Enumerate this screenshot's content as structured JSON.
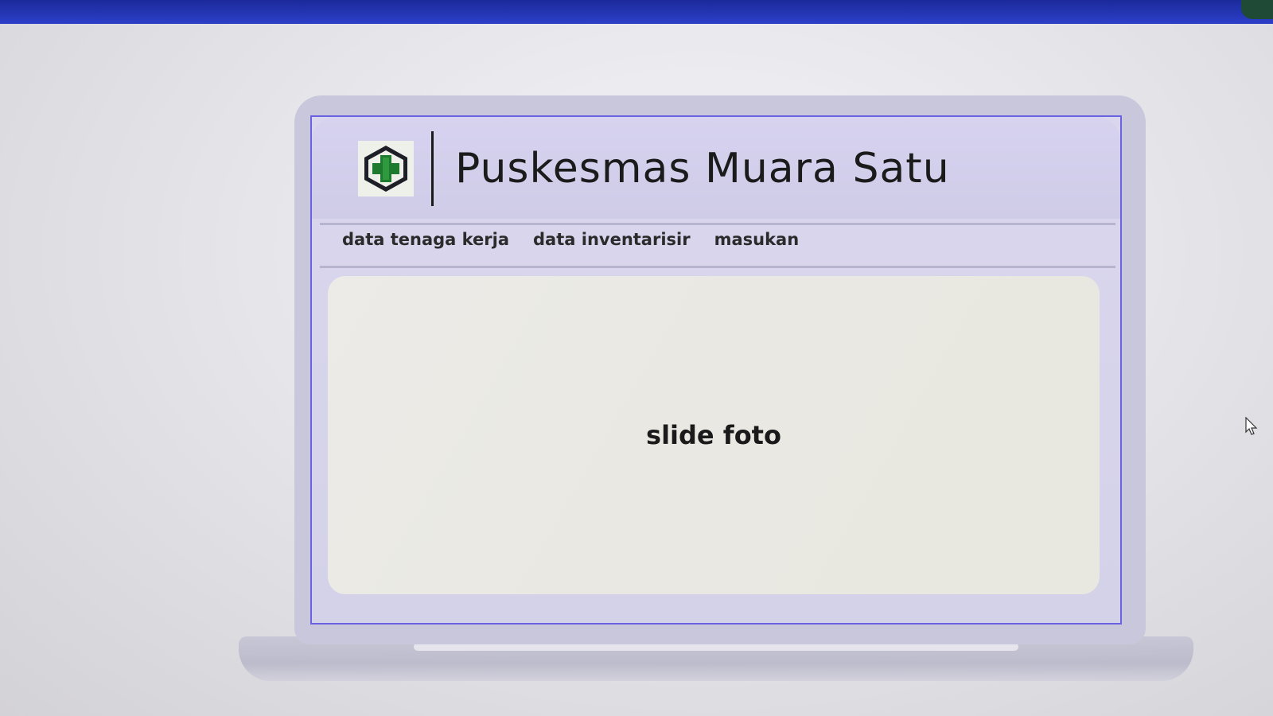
{
  "site": {
    "title": "Puskesmas Muara Satu",
    "logo": "puskesmas-cross-logo"
  },
  "nav": {
    "items": [
      {
        "label": "data tenaga kerja"
      },
      {
        "label": "data inventarisir"
      },
      {
        "label": "masukan"
      }
    ]
  },
  "main": {
    "slide_label": "slide foto"
  },
  "colors": {
    "top_bar": "#2434b8",
    "screen_border": "#6a62e0",
    "logo_green": "#1e7a2e",
    "logo_dark": "#1d1f26"
  }
}
